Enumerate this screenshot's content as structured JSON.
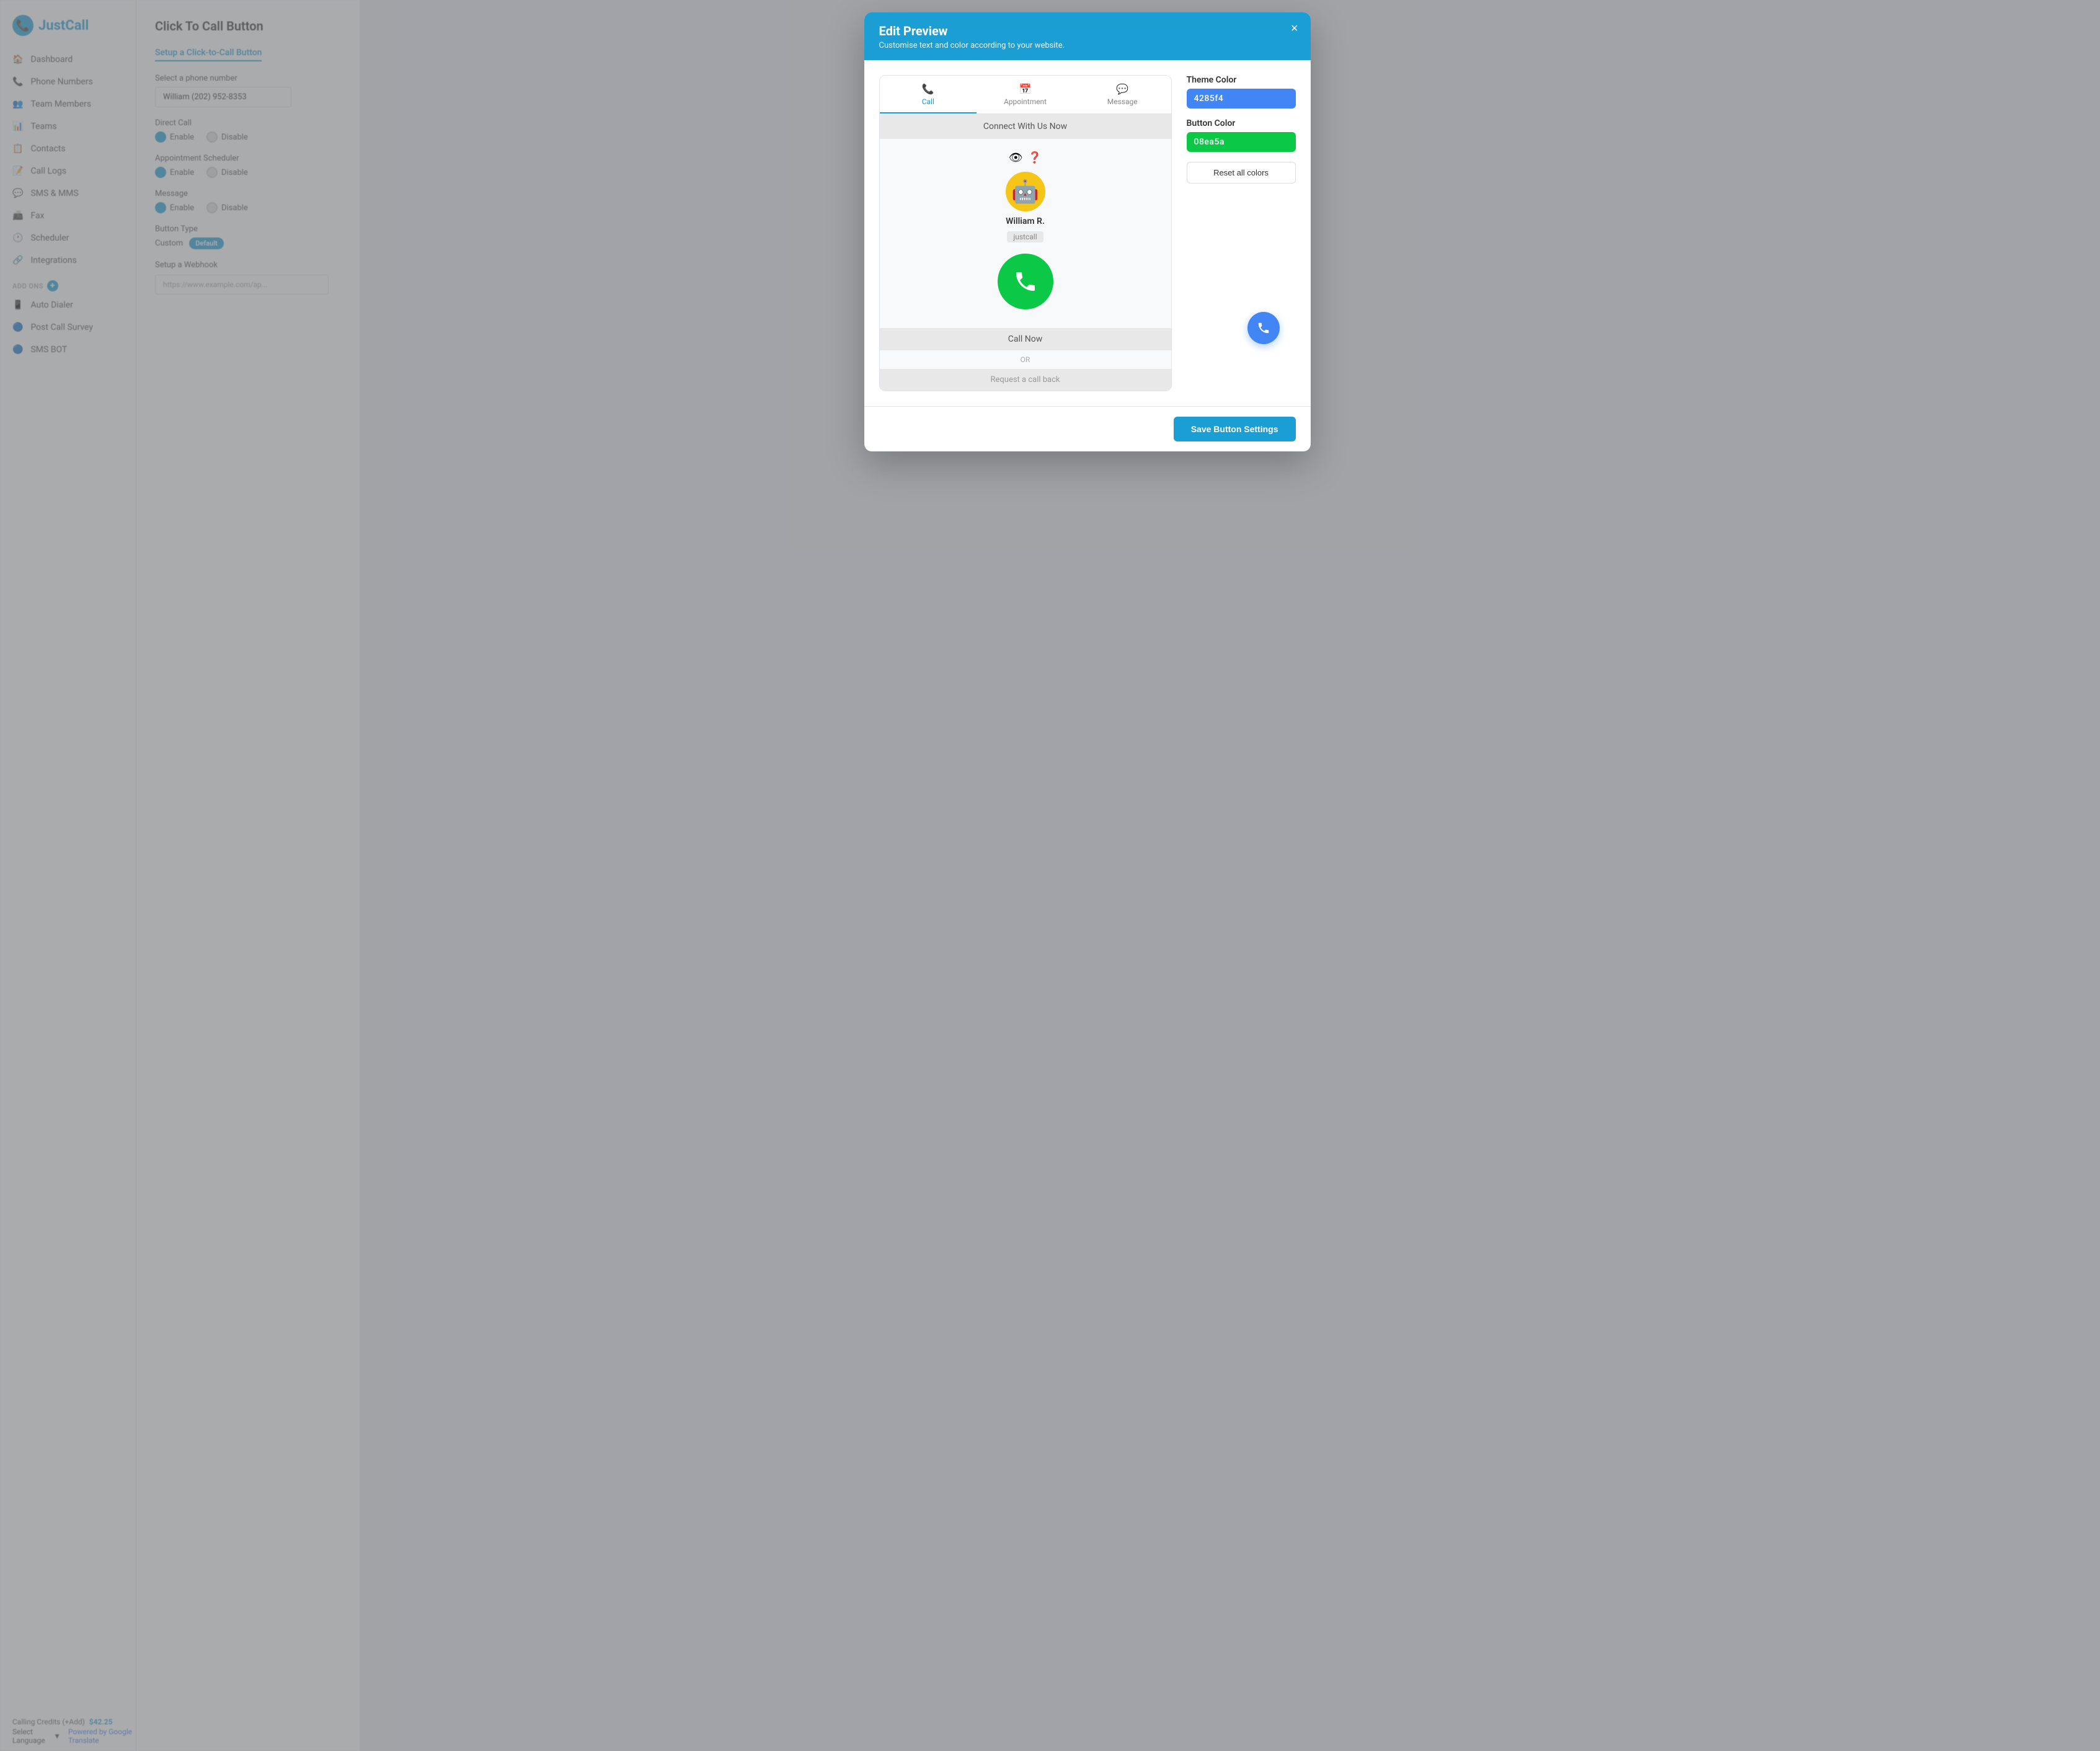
{
  "app": {
    "title": "JustCall",
    "page_title": "Click To Call Button"
  },
  "sidebar": {
    "logo": "JustCall",
    "items": [
      {
        "label": "Dashboard",
        "icon": "🏠"
      },
      {
        "label": "Phone Numbers",
        "icon": "📞"
      },
      {
        "label": "Team Members",
        "icon": "👥"
      },
      {
        "label": "Teams",
        "icon": "📊"
      },
      {
        "label": "Contacts",
        "icon": "📋"
      },
      {
        "label": "Call Logs",
        "icon": "📝"
      },
      {
        "label": "SMS & MMS",
        "icon": "💬"
      },
      {
        "label": "Fax",
        "icon": "📠"
      },
      {
        "label": "Scheduler",
        "icon": "🕐"
      },
      {
        "label": "Integrations",
        "icon": "🔗"
      }
    ],
    "addons_section": "ADD ONS",
    "addons": [
      {
        "label": "Auto Dialer",
        "icon": "📱"
      },
      {
        "label": "Post Call Survey",
        "icon": "🔵"
      },
      {
        "label": "SMS BOT",
        "icon": "🔵"
      }
    ],
    "credits_label": "Calling Credits (+Add)",
    "credits_amount": "$42.25",
    "language_label": "Select Language",
    "powered_by": "Powered by Google Translate"
  },
  "main": {
    "setup_label": "Setup a Click-to-Call Button",
    "form": {
      "phone_number_label": "Select a phone number",
      "phone_number_value": "William (202) 952-8353",
      "direct_call_label": "Direct Call",
      "appointment_label": "Appointment Scheduler",
      "message_label": "Message",
      "button_type_label": "Button Type",
      "custom_label": "Custom",
      "default_label": "Default",
      "webhook_label": "Setup a Webhook",
      "webhook_toggle": "ON",
      "webhook_placeholder": "https://www.example.com/ap..."
    }
  },
  "modal": {
    "title": "Edit Preview",
    "subtitle": "Customise text and color according to your website.",
    "close_label": "×",
    "tabs": [
      {
        "label": "Call",
        "icon": "📞"
      },
      {
        "label": "Appointment",
        "icon": "📅"
      },
      {
        "label": "Message",
        "icon": "💬"
      }
    ],
    "preview": {
      "header_text": "Connect With Us Now",
      "agent_name": "William R.",
      "agent_company": "justcall",
      "call_now_label": "Call Now",
      "or_label": "OR",
      "request_callback_label": "Request a call back"
    },
    "settings": {
      "theme_color_label": "Theme Color",
      "theme_color_value": "4285f4",
      "button_color_label": "Button Color",
      "button_color_value": "08ea5a",
      "reset_label": "Reset all colors"
    },
    "footer": {
      "save_label": "Save Button Settings"
    }
  }
}
